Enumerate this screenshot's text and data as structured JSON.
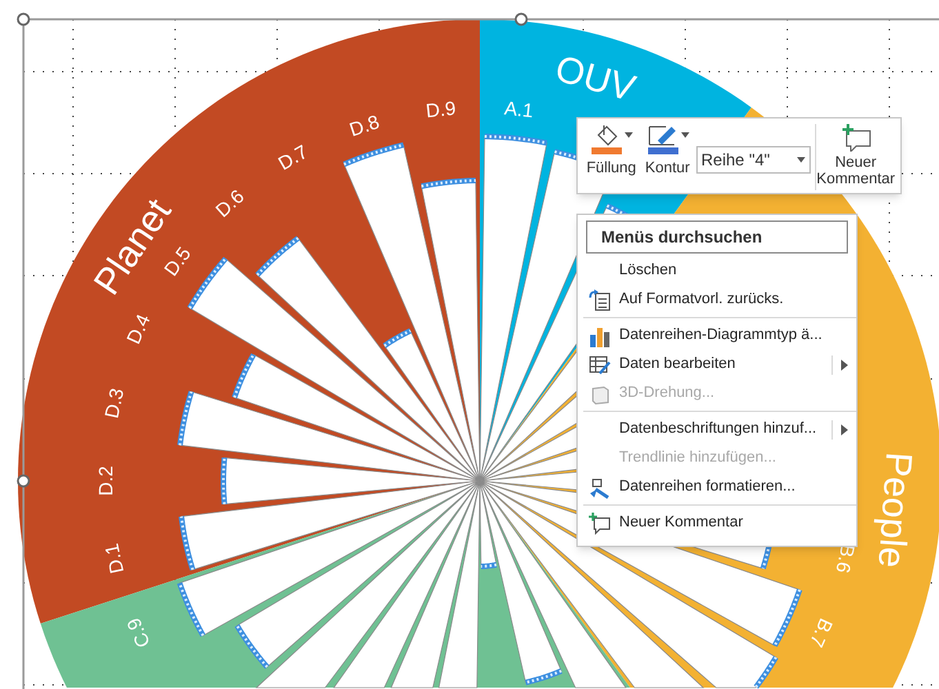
{
  "chart": {
    "series_selected": true,
    "groups": [
      {
        "name": "Planet",
        "color": "#c24a23"
      },
      {
        "name": "OUV",
        "color": "#00b4e0"
      },
      {
        "name": "People",
        "color": "#f3b132"
      },
      {
        "color": "#6fc193"
      }
    ],
    "labels": [
      "D.1",
      "D.2",
      "D.3",
      "D.4",
      "D.5",
      "D.6",
      "D.7",
      "D.8",
      "D.9",
      "A.1",
      "B.6",
      "B.7",
      "C.9"
    ]
  },
  "format_toolbar": {
    "fill": {
      "label": "Füllung",
      "color": "#f07a30"
    },
    "outline": {
      "label": "Kontur",
      "color": "#3f6fd0"
    },
    "series_select": {
      "value": "Reihe \"4\""
    },
    "comment_button": {
      "label": "Neuer Kommentar"
    }
  },
  "context_menu": {
    "search": {
      "placeholder": "Menüs durchsuchen"
    },
    "groups": [
      [
        {
          "label": "Löschen",
          "disabled": false,
          "submenu": false
        },
        {
          "label": "Auf Formatvorl. zurücks.",
          "disabled": false,
          "submenu": false
        }
      ],
      [
        {
          "label": "Datenreihen-Diagrammtyp ä...",
          "disabled": false,
          "submenu": false
        },
        {
          "label": "Daten bearbeiten",
          "disabled": false,
          "submenu": true
        },
        {
          "label": "3D-Drehung...",
          "disabled": true,
          "submenu": false
        }
      ],
      [
        {
          "label": "Datenbeschriftungen hinzuf...",
          "disabled": false,
          "submenu": true
        },
        {
          "label": "Trendlinie hinzufügen...",
          "disabled": true,
          "submenu": false
        },
        {
          "label": "Datenreihen formatieren...",
          "disabled": false,
          "submenu": false
        }
      ],
      [
        {
          "label": "Neuer Kommentar",
          "disabled": false,
          "submenu": false
        }
      ]
    ]
  }
}
